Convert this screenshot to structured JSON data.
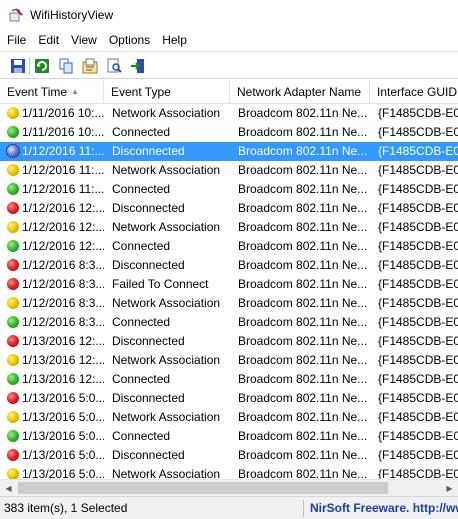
{
  "window": {
    "title": "WifiHistoryView"
  },
  "menu": [
    "File",
    "Edit",
    "View",
    "Options",
    "Help"
  ],
  "toolbar": {
    "buttons": [
      "save-icon",
      "refresh-icon",
      "copy-icon",
      "properties-icon",
      "find-icon",
      "exit-icon"
    ]
  },
  "columns": [
    "Event Time",
    "Event Type",
    "Network Adapter Name",
    "Interface GUID"
  ],
  "rows": [
    {
      "status": "yellow",
      "time": "1/11/2016 10:...",
      "type": "Network Association",
      "adapter": "Broadcom 802.11n Ne...",
      "guid": "{F1485CDB-E00"
    },
    {
      "status": "green",
      "time": "1/11/2016 10:...",
      "type": "Connected",
      "adapter": "Broadcom 802.11n Ne...",
      "guid": "{F1485CDB-E00"
    },
    {
      "status": "blue",
      "time": "1/12/2016 11:...",
      "type": "Disconnected",
      "adapter": "Broadcom 802.11n Ne...",
      "guid": "{F1485CDB-E00",
      "selected": true
    },
    {
      "status": "yellow",
      "time": "1/12/2016 11:...",
      "type": "Network Association",
      "adapter": "Broadcom 802.11n Ne...",
      "guid": "{F1485CDB-E00"
    },
    {
      "status": "green",
      "time": "1/12/2016 11:...",
      "type": "Connected",
      "adapter": "Broadcom 802.11n Ne...",
      "guid": "{F1485CDB-E00"
    },
    {
      "status": "red",
      "time": "1/12/2016 12:...",
      "type": "Disconnected",
      "adapter": "Broadcom 802.11n Ne...",
      "guid": "{F1485CDB-E00"
    },
    {
      "status": "yellow",
      "time": "1/12/2016 12:...",
      "type": "Network Association",
      "adapter": "Broadcom 802.11n Ne...",
      "guid": "{F1485CDB-E00"
    },
    {
      "status": "green",
      "time": "1/12/2016 12:...",
      "type": "Connected",
      "adapter": "Broadcom 802.11n Ne...",
      "guid": "{F1485CDB-E00"
    },
    {
      "status": "red",
      "time": "1/12/2016 8:3...",
      "type": "Disconnected",
      "adapter": "Broadcom 802.11n Ne...",
      "guid": "{F1485CDB-E00"
    },
    {
      "status": "red",
      "time": "1/12/2016 8:3...",
      "type": "Failed To Connect",
      "adapter": "Broadcom 802.11n Ne...",
      "guid": "{F1485CDB-E00"
    },
    {
      "status": "yellow",
      "time": "1/12/2016 8:3...",
      "type": "Network Association",
      "adapter": "Broadcom 802.11n Ne...",
      "guid": "{F1485CDB-E00"
    },
    {
      "status": "green",
      "time": "1/12/2016 8:3...",
      "type": "Connected",
      "adapter": "Broadcom 802.11n Ne...",
      "guid": "{F1485CDB-E00"
    },
    {
      "status": "red",
      "time": "1/13/2016 12:...",
      "type": "Disconnected",
      "adapter": "Broadcom 802.11n Ne...",
      "guid": "{F1485CDB-E00"
    },
    {
      "status": "yellow",
      "time": "1/13/2016 12:...",
      "type": "Network Association",
      "adapter": "Broadcom 802.11n Ne...",
      "guid": "{F1485CDB-E00"
    },
    {
      "status": "green",
      "time": "1/13/2016 12:...",
      "type": "Connected",
      "adapter": "Broadcom 802.11n Ne...",
      "guid": "{F1485CDB-E00"
    },
    {
      "status": "red",
      "time": "1/13/2016 5:0...",
      "type": "Disconnected",
      "adapter": "Broadcom 802.11n Ne...",
      "guid": "{F1485CDB-E00"
    },
    {
      "status": "yellow",
      "time": "1/13/2016 5:0...",
      "type": "Network Association",
      "adapter": "Broadcom 802.11n Ne...",
      "guid": "{F1485CDB-E00"
    },
    {
      "status": "green",
      "time": "1/13/2016 5:0...",
      "type": "Connected",
      "adapter": "Broadcom 802.11n Ne...",
      "guid": "{F1485CDB-E00"
    },
    {
      "status": "red",
      "time": "1/13/2016 5:0...",
      "type": "Disconnected",
      "adapter": "Broadcom 802.11n Ne...",
      "guid": "{F1485CDB-E00"
    },
    {
      "status": "yellow",
      "time": "1/13/2016 5:0...",
      "type": "Network Association",
      "adapter": "Broadcom 802.11n Ne...",
      "guid": "{F1485CDB-E00"
    }
  ],
  "status": {
    "count": "383 item(s), 1 Selected",
    "link": "NirSoft Freeware.  http://ww"
  },
  "colors": {
    "selection": "#3399ff",
    "link": "#1a3fae"
  }
}
